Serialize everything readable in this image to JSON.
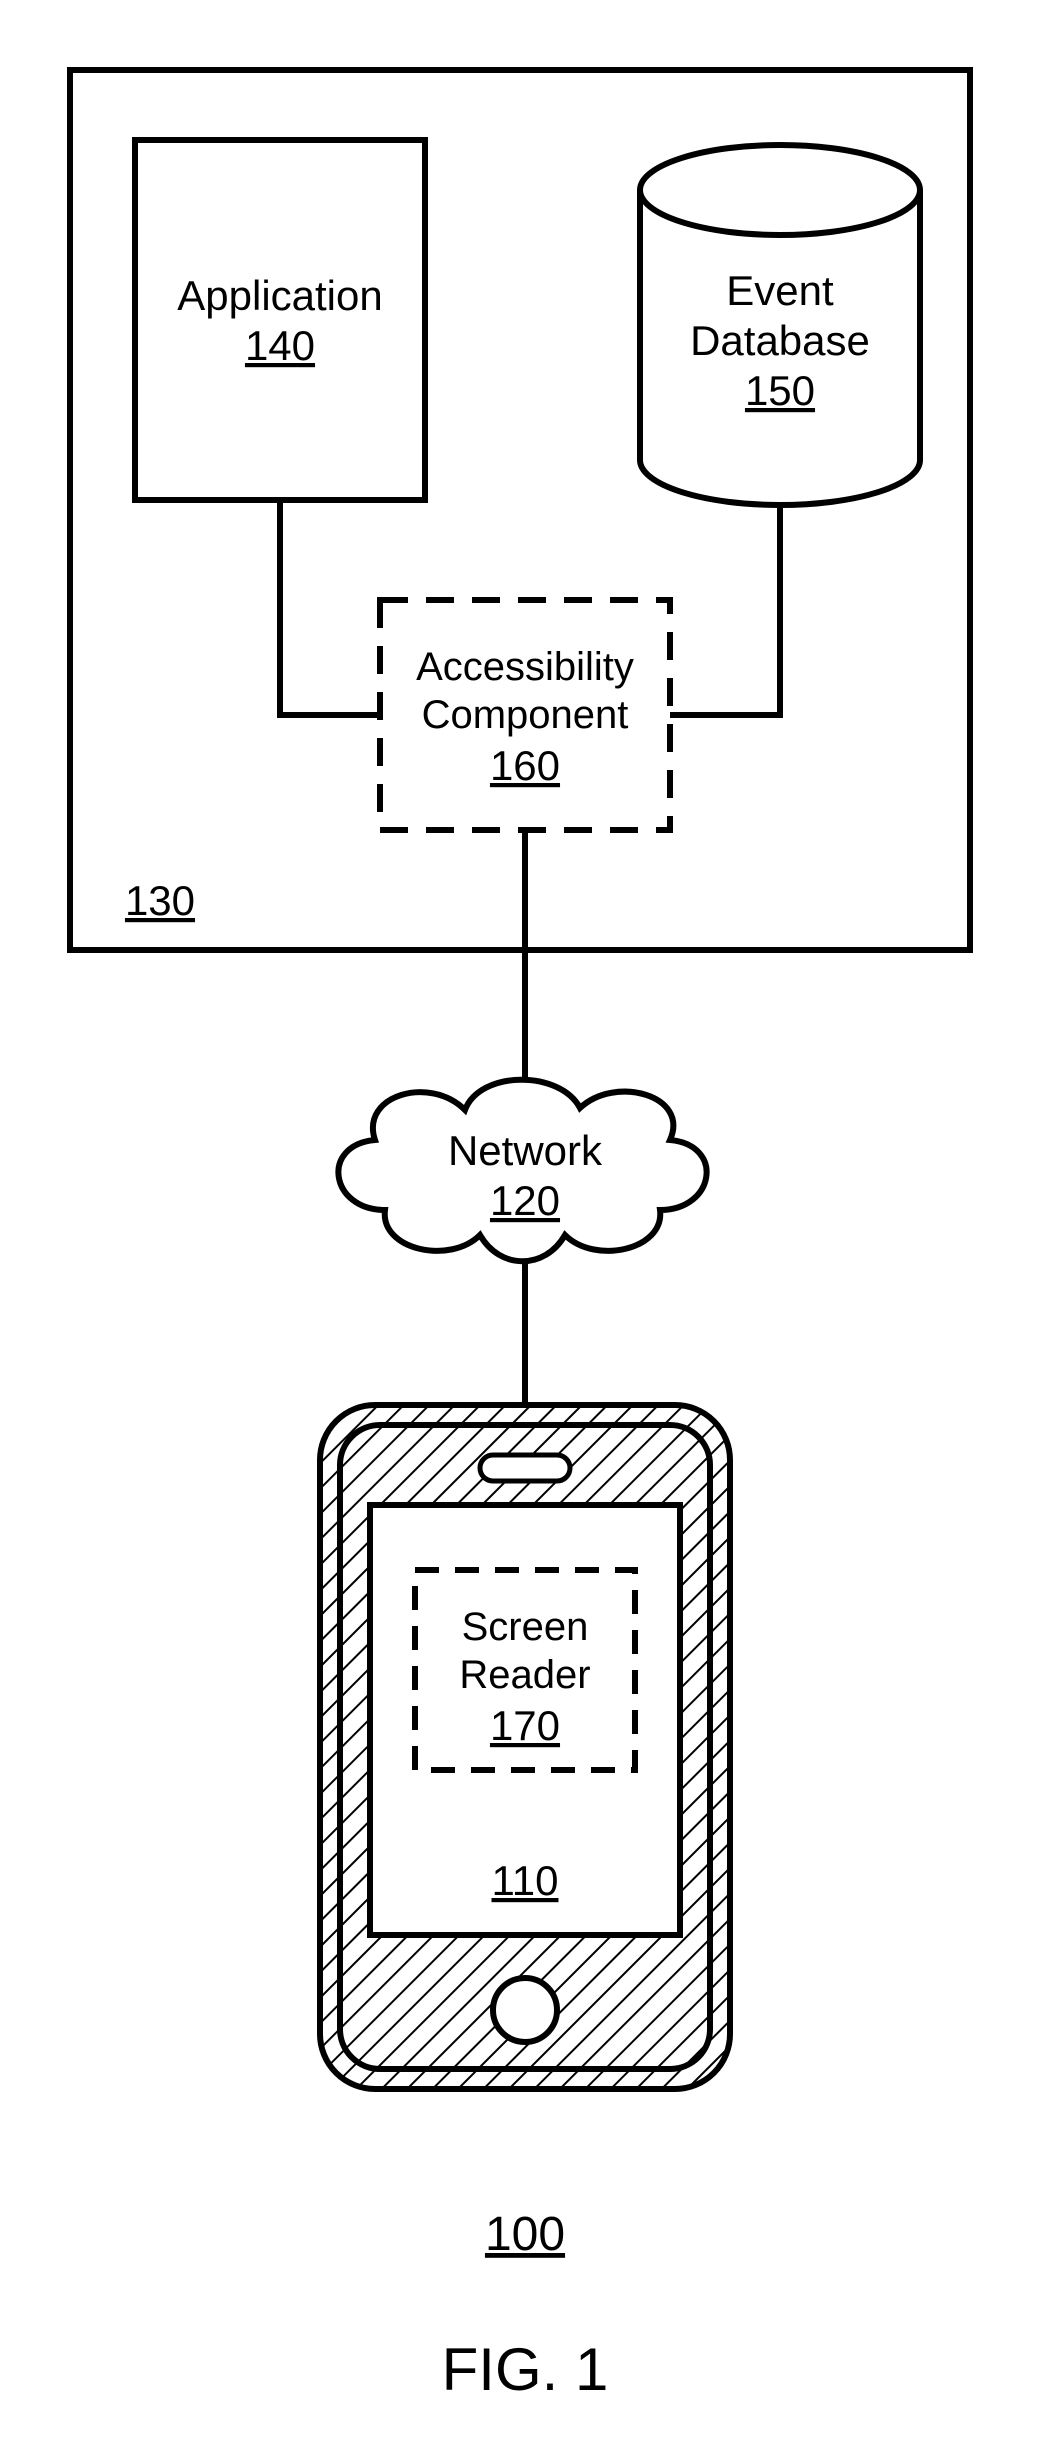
{
  "figure": {
    "caption": "FIG. 1",
    "system_ref": "100"
  },
  "server": {
    "ref": "130",
    "application": {
      "label": "Application",
      "ref": "140"
    },
    "database": {
      "label_line1": "Event",
      "label_line2": "Database",
      "ref": "150"
    },
    "accessibility": {
      "label_line1": "Accessibility",
      "label_line2": "Component",
      "ref": "160"
    }
  },
  "network": {
    "label": "Network",
    "ref": "120"
  },
  "client": {
    "ref": "110",
    "screen_reader": {
      "label_line1": "Screen",
      "label_line2": "Reader",
      "ref": "170"
    }
  }
}
